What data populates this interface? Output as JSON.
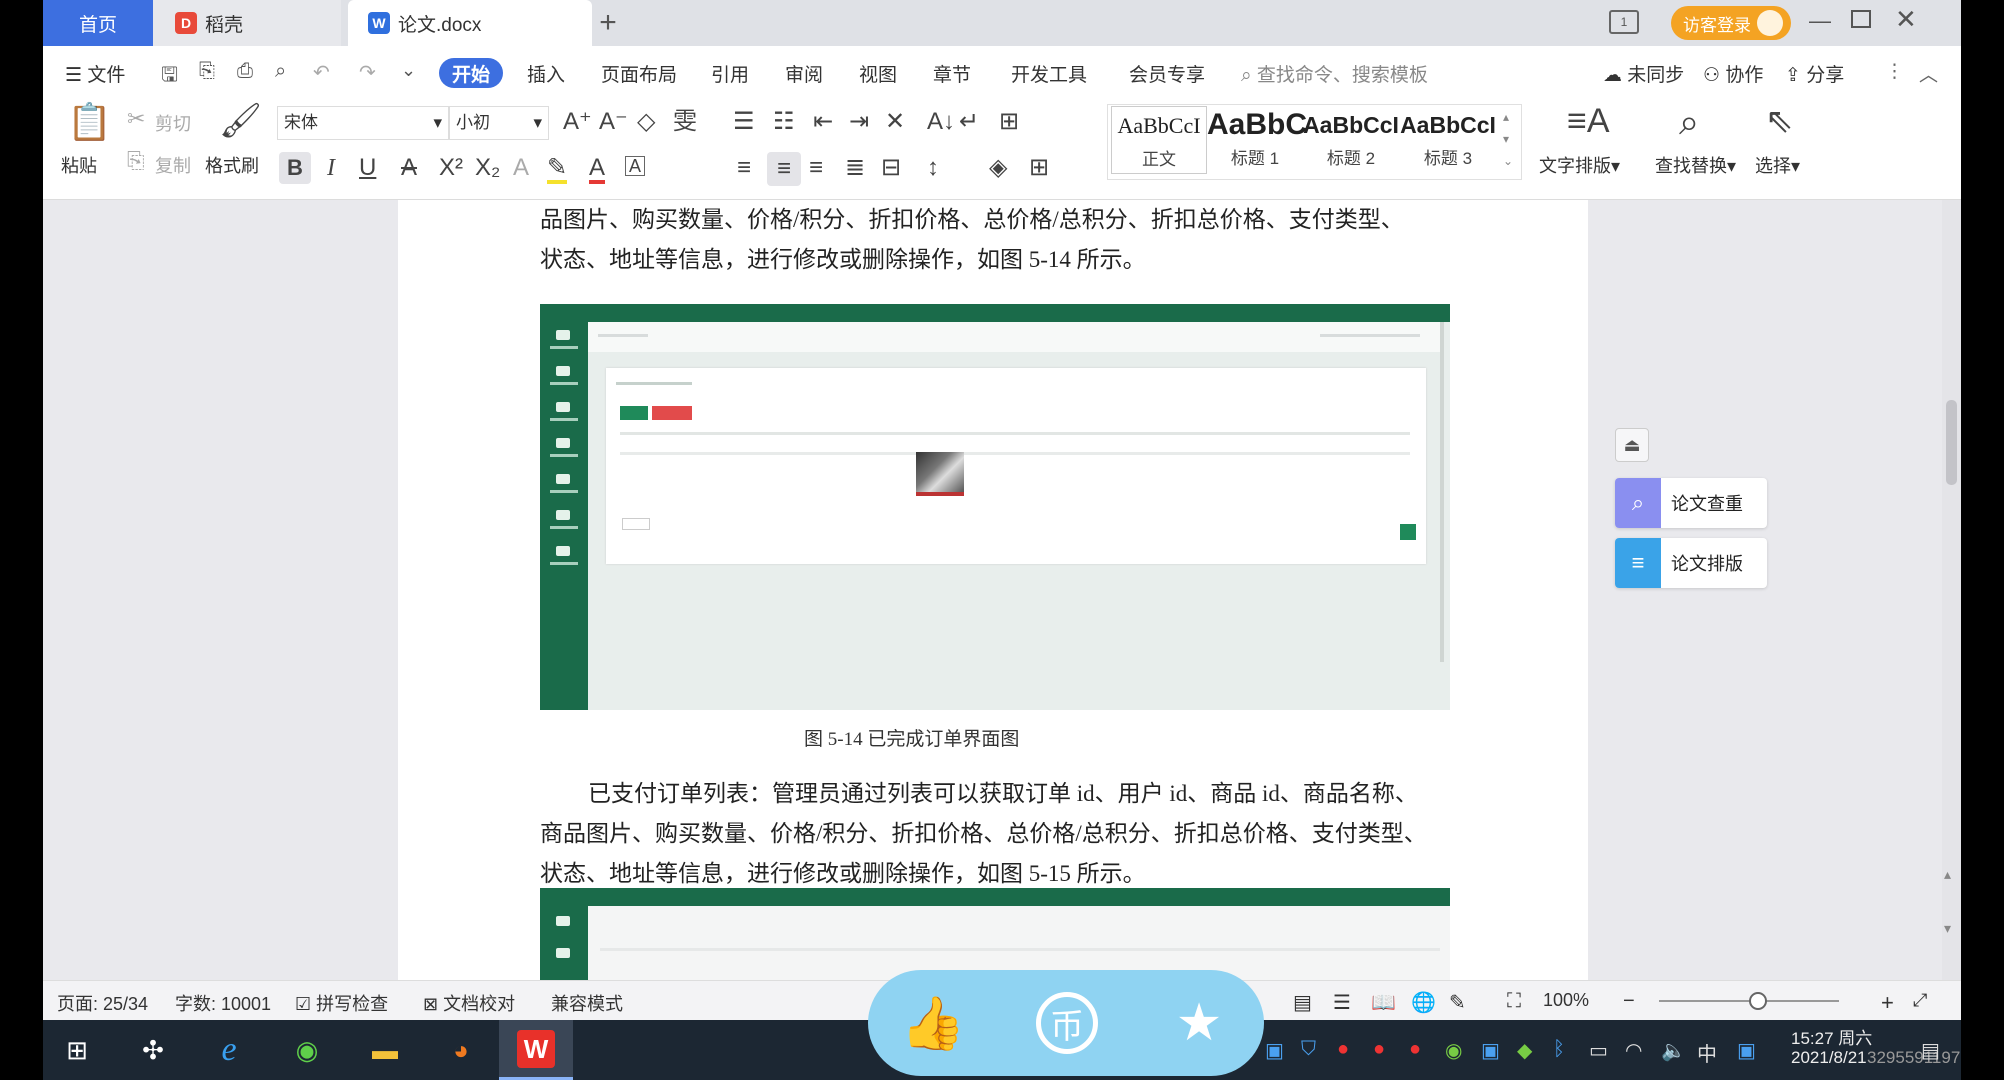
{
  "tabs": {
    "home": "首页",
    "daoke": "稻壳",
    "doc": "论文.docx",
    "add": "+",
    "login": "访客登录"
  },
  "menu": {
    "file": "文件",
    "items": [
      "开始",
      "插入",
      "页面布局",
      "引用",
      "审阅",
      "视图",
      "章节",
      "开发工具",
      "会员专享"
    ],
    "search_placeholder": "查找命令、搜索模板",
    "sync": "未同步",
    "collab": "协作",
    "share": "分享"
  },
  "ribbon": {
    "paste": "粘贴",
    "cut": "剪切",
    "copy": "复制",
    "format_painter": "格式刷",
    "font_name": "宋体",
    "font_size": "小初",
    "styles": [
      {
        "sample": "AaBbCcI",
        "name": "正文"
      },
      {
        "sample": "AaBbC",
        "name": "标题 1"
      },
      {
        "sample": "AaBbCcI",
        "name": "标题 2"
      },
      {
        "sample": "AaBbCcI",
        "name": "标题 3"
      }
    ],
    "text_layout": "文字排版",
    "find_replace": "查找替换",
    "select": "选择"
  },
  "document": {
    "para1_line1": "品图片、购买数量、价格/积分、折扣价格、总价格/总积分、折扣总价格、支付类型、",
    "para1_line2": "状态、地址等信息，进行修改或删除操作，如图 5-14 所示。",
    "figure1_caption": "图 5-14 已完成订单界面图",
    "para2_line1": "已支付订单列表：管理员通过列表可以获取订单 id、用户 id、商品 id、商品名称、",
    "para2_line2": "商品图片、购买数量、价格/积分、折扣价格、总价格/总积分、折扣总价格、支付类型、",
    "para2_line3": "状态、地址等信息，进行修改或删除操作，如图 5-15 所示。"
  },
  "side_panel": {
    "check": "论文查重",
    "layout": "论文排版"
  },
  "status": {
    "page": "页面: 25/34",
    "words": "字数: 10001",
    "spell": "拼写检查",
    "proof": "文档校对",
    "compat": "兼容模式",
    "zoom": "100%"
  },
  "taskbar": {
    "time": "15:27 周六",
    "date": "2021/8/21",
    "ime": "中",
    "watermark": "3295591197"
  }
}
